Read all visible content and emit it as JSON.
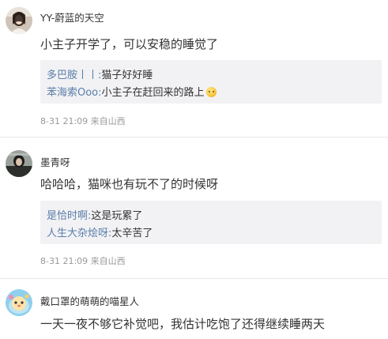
{
  "comments": [
    {
      "username": "YY-蔚蓝的天空",
      "text": "小主子开学了，可以安稳的睡觉了",
      "replies": [
        {
          "name": "多巴胺丨丨",
          "sep": ":",
          "text": "猫子好好睡",
          "emoji": ""
        },
        {
          "name": "苯海索Ooo",
          "sep": ":",
          "text": "小主子在赶回来的路上",
          "emoji": "smile-emoji"
        }
      ],
      "time": "8-31 21:09",
      "source": "来自山西"
    },
    {
      "username": "墨青呀",
      "text": "哈哈哈，猫咪也有玩不了的时候呀",
      "replies": [
        {
          "name": "是恰时啊",
          "sep": ":",
          "text": "这是玩累了"
        },
        {
          "name": "人生大杂烩呀",
          "sep": ":",
          "text": "太辛苦了"
        }
      ],
      "time": "8-31 21:09",
      "source": "来自山西"
    },
    {
      "username": "戴口罩的萌萌的喵星人",
      "text": "一天一夜不够它补觉吧，我估计吃饱了还得继续睡两天"
    }
  ],
  "colors": {
    "link": "#5a7ea8",
    "text": "#333333",
    "meta": "#999999",
    "reply_bg": "#f2f2f5",
    "divider": "#e8e8e8"
  }
}
